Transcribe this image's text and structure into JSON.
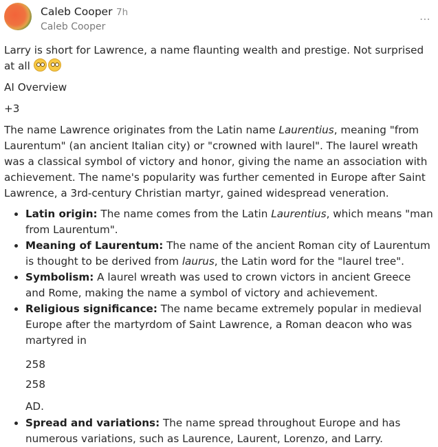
{
  "post": {
    "author": "Caleb Cooper",
    "time": "7h",
    "subname": "Caleb Cooper",
    "more_icon": "⋯",
    "text": "Larry is short for Lawrence, a name flaunting wealth and prestige. Not surprised at all",
    "emojis": [
      "eye-roll-emoji",
      "eye-roll-emoji"
    ]
  },
  "overview": {
    "label": "AI Overview",
    "extra_count": "+3",
    "intro_a": "The name Lawrence originates from the Latin name ",
    "intro_em": "Laurentius",
    "intro_b": ", meaning \"from Laurentum\" (an ancient Italian city) or \"crowned with laurel\". The laurel wreath was a classical symbol of victory and honor, giving the name an association with achievement. The name's popularity was further cemented in Europe after Saint Lawrence, a 3rd-century Christian martyr, gained widespread veneration.",
    "items": [
      {
        "bold": "Latin origin:",
        "a": " The name comes from the Latin ",
        "em": "Laurentius",
        "b": ", which means \"man from Laurentum\"."
      },
      {
        "bold": "Meaning of Laurentum:",
        "a": " The name of the ancient Roman city of Laurentum is thought to be derived from ",
        "em": "laurus",
        "b": ", the Latin word for the \"laurel tree\"."
      },
      {
        "bold": "Symbolism:",
        "a": " A laurel wreath was used to crown victors in ancient Greece and Rome, making the name a symbol of victory and achievement."
      },
      {
        "bold": "Religious significance:",
        "a": " The name became extremely popular in medieval Europe after the martyrdom of Saint Lawrence, a Roman deacon who was martyred in",
        "year1": "258",
        "year2": "258",
        "ad": "AD."
      },
      {
        "bold": "Spread and variations:",
        "a": " The name spread throughout Europe and has numerous variations, such as Laurence, Laurent, Lorenzo, and Larry."
      }
    ]
  }
}
